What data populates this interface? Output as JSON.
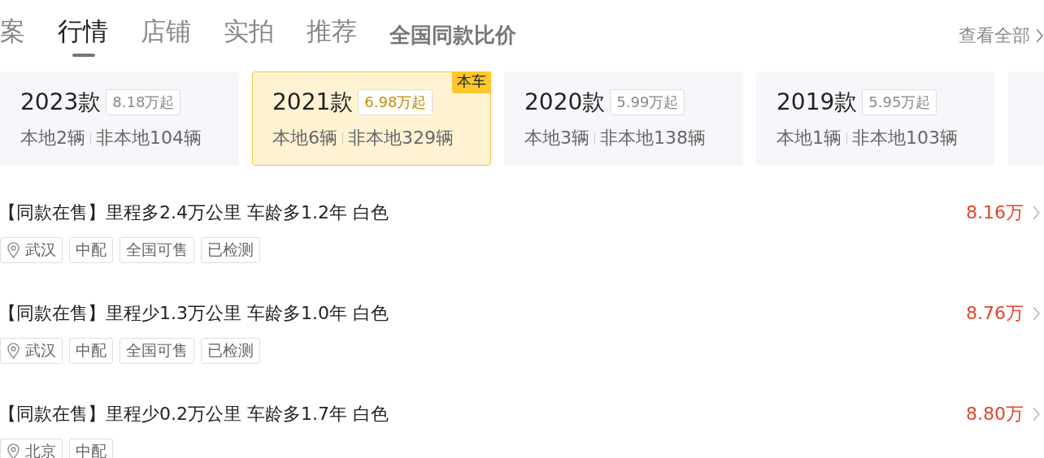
{
  "tabs": [
    {
      "label": "案",
      "selected": false
    },
    {
      "label": "行情",
      "selected": true
    },
    {
      "label": "店铺",
      "selected": false
    },
    {
      "label": "实拍",
      "selected": false
    },
    {
      "label": "推荐",
      "selected": false
    }
  ],
  "section_title": "全国同款比价",
  "view_all": "查看全部",
  "years": [
    {
      "year": "2023款",
      "price": "8.18万起",
      "local": "本地2辆",
      "nonlocal": "非本地104辆",
      "selected": false
    },
    {
      "year": "2021款",
      "price": "6.98万起",
      "local": "本地6辆",
      "nonlocal": "非本地329辆",
      "selected": true,
      "badge": "本车"
    },
    {
      "year": "2020款",
      "price": "5.99万起",
      "local": "本地3辆",
      "nonlocal": "非本地138辆",
      "selected": false
    },
    {
      "year": "2019款",
      "price": "5.95万起",
      "local": "本地1辆",
      "nonlocal": "非本地103辆",
      "selected": false
    }
  ],
  "listings": [
    {
      "title": "【同款在售】里程多2.4万公里 车龄多1.2年 白色",
      "price": "8.16万",
      "tags": [
        {
          "kind": "location",
          "label": "武汉"
        },
        {
          "kind": "plain",
          "label": "中配"
        },
        {
          "kind": "plain",
          "label": "全国可售"
        },
        {
          "kind": "plain",
          "label": "已检测"
        }
      ]
    },
    {
      "title": "【同款在售】里程少1.3万公里 车龄多1.0年 白色",
      "price": "8.76万",
      "tags": [
        {
          "kind": "location",
          "label": "武汉"
        },
        {
          "kind": "plain",
          "label": "中配"
        },
        {
          "kind": "plain",
          "label": "全国可售"
        },
        {
          "kind": "plain",
          "label": "已检测"
        }
      ]
    },
    {
      "title": "【同款在售】里程少0.2万公里 车龄多1.7年 白色",
      "price": "8.80万",
      "tags": [
        {
          "kind": "location",
          "label": "北京"
        },
        {
          "kind": "plain",
          "label": "中配"
        }
      ]
    }
  ]
}
